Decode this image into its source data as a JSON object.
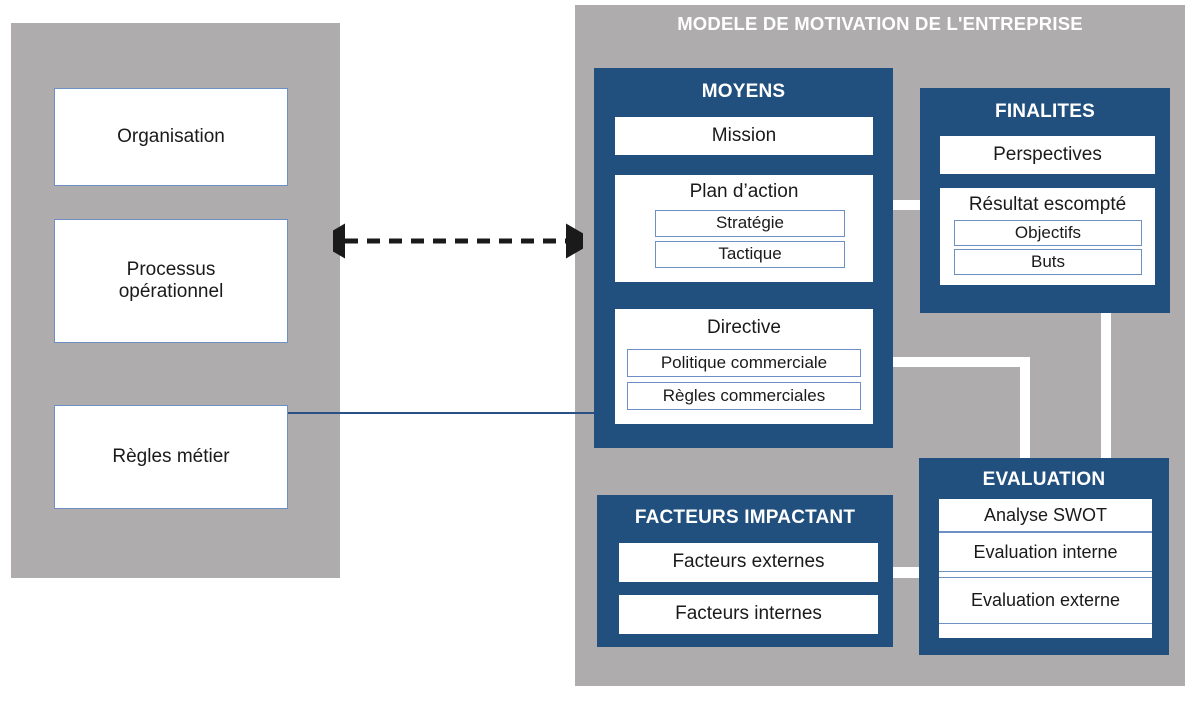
{
  "diagram": {
    "title": "MODELE DE MOTIVATION DE L'ENTREPRISE",
    "colors": {
      "panel_gray": "#AEACAC",
      "block_blue": "#22507E",
      "box_border_blue": "#6E8FC4",
      "connector_white": "#FFFFFF",
      "text_dark": "#1A1A1A",
      "text_light": "#FFFFFF"
    }
  },
  "left_panel": {
    "name": "contexte-entreprise",
    "items": [
      {
        "label": "Organisation"
      },
      {
        "label": "Processus\noperationnel",
        "line1": "Processus",
        "line2": "opérationnel"
      },
      {
        "label": "Règles métier"
      }
    ]
  },
  "moyens": {
    "title": "MOYENS",
    "mission": {
      "label": "Mission"
    },
    "plan_action": {
      "label": "Plan d’action",
      "children": [
        {
          "label": "Stratégie"
        },
        {
          "label": "Tactique"
        }
      ]
    },
    "directive": {
      "label": "Directive",
      "children": [
        {
          "label": "Politique commerciale"
        },
        {
          "label": "Règles commerciales"
        }
      ]
    }
  },
  "finalites": {
    "title": "FINALITES",
    "perspectives": {
      "label": "Perspectives"
    },
    "resultat_escompte": {
      "label": "Résultat escompté",
      "children": [
        {
          "label": "Objectifs"
        },
        {
          "label": "Buts"
        }
      ]
    }
  },
  "facteurs_impactant": {
    "title": "FACTEURS IMPACTANT",
    "items": [
      {
        "label": "Facteurs externes"
      },
      {
        "label": "Facteurs internes"
      }
    ]
  },
  "evaluation": {
    "title": "EVALUATION",
    "items": [
      {
        "label": "Analyse SWOT"
      },
      {
        "label": "Evaluation interne"
      },
      {
        "label": "Evaluation externe"
      }
    ]
  },
  "connectors": {
    "bidirectional_dashed": {
      "name": "organisation-moyens-link"
    },
    "regles_metier_line": {
      "name": "regles-metier-directive-link"
    },
    "moyens_finalites": {
      "name": "moyens-finalites-link"
    },
    "moyens_evaluation": {
      "name": "moyens-evaluation-link"
    },
    "finalites_evaluation": {
      "name": "finalites-evaluation-link"
    },
    "facteurs_evaluation": {
      "name": "facteurs-evaluation-link"
    }
  }
}
